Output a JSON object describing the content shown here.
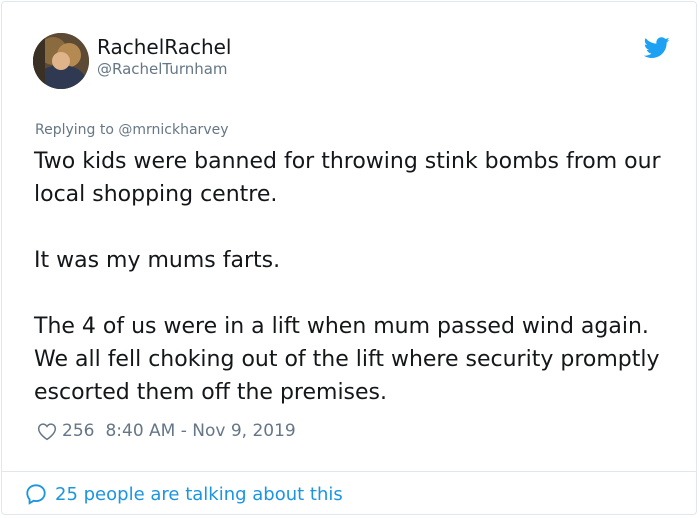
{
  "author": {
    "display_name": "RachelRachel",
    "handle": "@RachelTurnham"
  },
  "reply": {
    "prefix": "Replying to ",
    "mention": "@mrnickharvey"
  },
  "tweet": {
    "paragraphs": [
      "Two kids were banned for throwing stink bombs from our local shopping centre.",
      "It was my mums farts.",
      "The 4 of us were in a lift when mum passed wind again. We all fell choking out of the lift where security promptly escorted them off the premises."
    ]
  },
  "meta": {
    "likes": "256",
    "timestamp": "8:40 AM - Nov 9, 2019"
  },
  "footer": {
    "conversation_label": "25 people are talking about this"
  },
  "icons": {
    "brand": "twitter-bird-icon",
    "like": "heart-icon",
    "reply": "speech-bubble-icon"
  },
  "colors": {
    "accent": "#1da1f2",
    "link": "#1b95e0",
    "secondary_text": "#657786",
    "primary_text": "#14171a"
  }
}
